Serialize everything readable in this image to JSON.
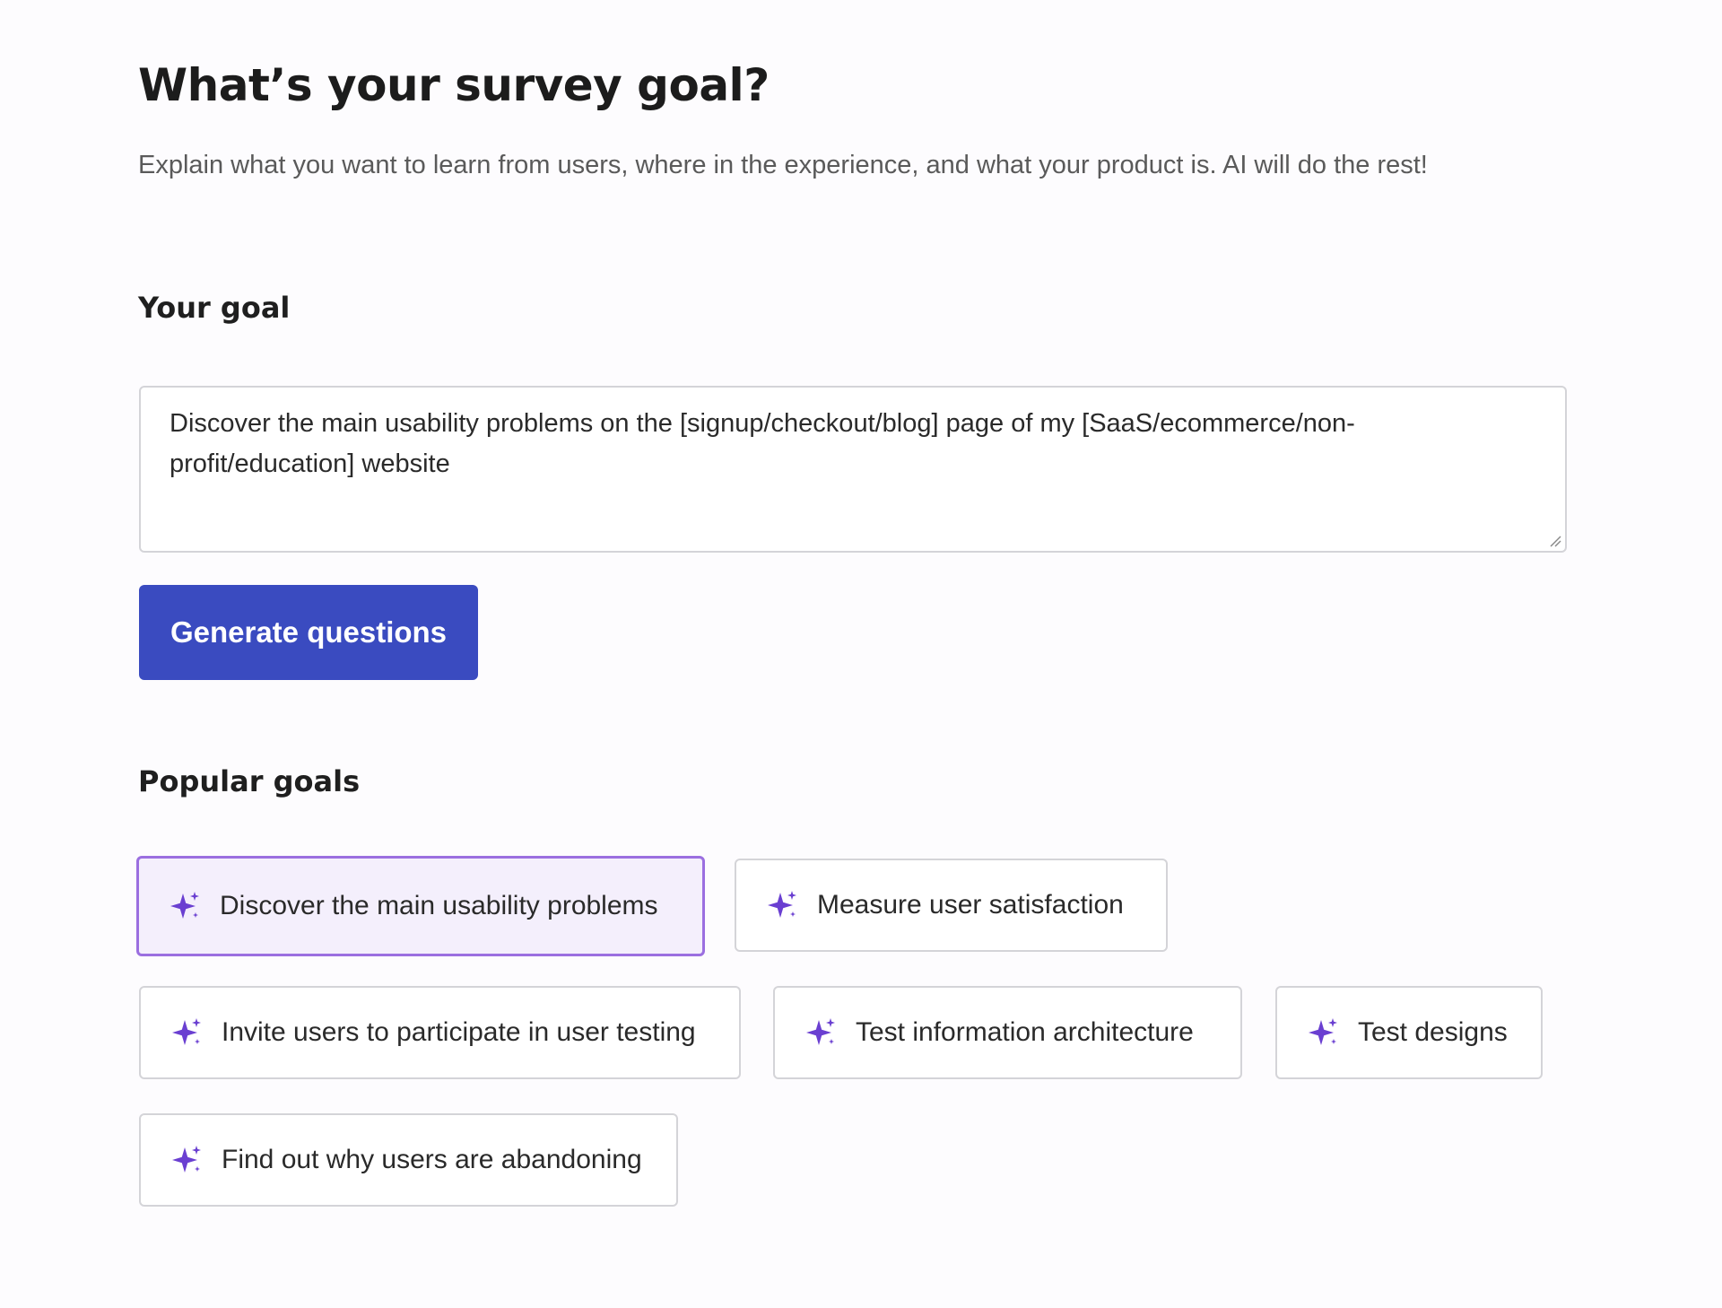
{
  "header": {
    "title": "What’s your survey goal?",
    "subtitle": "Explain what you want to learn from users, where in the experience, and what your product is. AI will do the rest!"
  },
  "goal": {
    "label": "Your goal",
    "value": "Discover the main usability problems on the [signup/checkout/blog] page of my [SaaS/ecommerce/non-profit/education] website",
    "generate_label": "Generate questions"
  },
  "popular": {
    "label": "Popular goals",
    "chips": [
      {
        "label": "Discover the main usability problems",
        "selected": true,
        "icon": "sparkle-icon"
      },
      {
        "label": "Measure user satisfaction",
        "selected": false,
        "icon": "sparkle-icon"
      },
      {
        "label": "Invite users to participate in user testing",
        "selected": false,
        "icon": "sparkle-icon"
      },
      {
        "label": "Test information architecture",
        "selected": false,
        "icon": "sparkle-icon"
      },
      {
        "label": "Test designs",
        "selected": false,
        "icon": "sparkle-icon"
      },
      {
        "label": "Find out why users are abandoning",
        "selected": false,
        "icon": "sparkle-icon"
      }
    ]
  },
  "colors": {
    "primary": "#3a4bc0",
    "sparkle": "#6a3fd1",
    "selected_border": "#9b6fe0",
    "selected_bg": "#f4effc"
  }
}
